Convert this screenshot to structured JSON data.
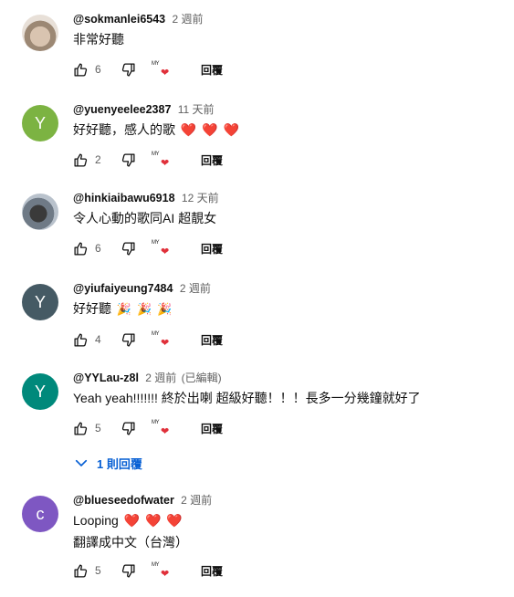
{
  "comments": [
    {
      "author": "@sokmanlei6543",
      "time": "2 週前",
      "edited": "",
      "text": "非常好聽",
      "text2": "",
      "likes": "6",
      "avatar_letter": "",
      "avatar_color": "",
      "hearts": 0,
      "emoji": ""
    },
    {
      "author": "@yuenyeelee2387",
      "time": "11 天前",
      "edited": "",
      "text": "好好聽，感人的歌",
      "text2": "",
      "likes": "2",
      "avatar_letter": "Y",
      "avatar_color": "#7cb342",
      "hearts": 3,
      "emoji": "❤️"
    },
    {
      "author": "@hinkiaibawu6918",
      "time": "12 天前",
      "edited": "",
      "text": "令人心動的歌同AI 超靚女",
      "text2": "",
      "likes": "6",
      "avatar_letter": "",
      "avatar_color": "",
      "hearts": 0,
      "emoji": ""
    },
    {
      "author": "@yiufaiyeung7484",
      "time": "2 週前",
      "edited": "",
      "text": "好好聽",
      "text2": "",
      "likes": "4",
      "avatar_letter": "Y",
      "avatar_color": "#455a64",
      "hearts": 3,
      "emoji": "🎉"
    },
    {
      "author": "@YYLau-z8l",
      "time": "2 週前",
      "edited": "(已編輯)",
      "text": "Yeah yeah!!!!!!! 終於出喇 超級好聽！！！長多一分幾鐘就好了",
      "text2": "",
      "likes": "5",
      "avatar_letter": "Y",
      "avatar_color": "#00897b",
      "hearts": 0,
      "emoji": ""
    },
    {
      "author": "@blueseedofwater",
      "time": "2 週前",
      "edited": "",
      "text": "Looping",
      "text2": "翻譯成中文（台灣）",
      "likes": "5",
      "avatar_letter": "c",
      "avatar_color": "#7e57c2",
      "hearts": 3,
      "emoji": "❤️"
    }
  ],
  "actions": {
    "reply_label": "回覆",
    "creator_tag": "MY"
  },
  "replies_toggle": "1 則回覆",
  "colors": {
    "link": "#065fd4",
    "heart": "#e0303a",
    "meta": "#606060"
  }
}
